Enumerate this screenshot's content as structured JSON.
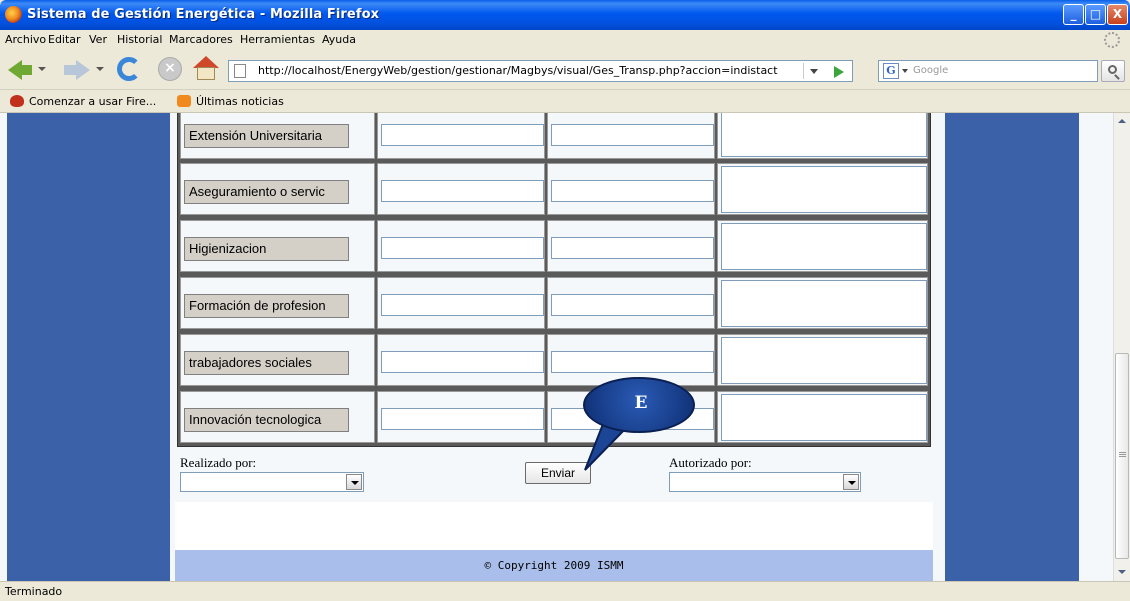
{
  "window": {
    "title": "Sistema de Gestión Energética - Mozilla Firefox",
    "min_glyph": "_",
    "max_glyph": "□",
    "close_glyph": "X"
  },
  "menu": {
    "items": [
      "Archivo",
      "Editar",
      "Ver",
      "Historial",
      "Marcadores",
      "Herramientas",
      "Ayuda"
    ]
  },
  "toolbar": {
    "url": "http://localhost/EnergyWeb/gestion/gestionar/Magbys/visual/Ges_Transp.php?accion=indistact",
    "search_placeholder": "Google",
    "search_engine_glyph": "G",
    "stop_glyph": "×"
  },
  "bookmarks": {
    "items": [
      "Comenzar a usar Fire...",
      "Últimas noticias"
    ]
  },
  "form": {
    "rows": [
      {
        "label": "Extensión Universitaria"
      },
      {
        "label": "Aseguramiento o servic"
      },
      {
        "label": "Higienizacion"
      },
      {
        "label": "Formación de profesion"
      },
      {
        "label": "trabajadores sociales"
      },
      {
        "label": "Innovación tecnologica"
      }
    ],
    "realizado_label": "Realizado por:",
    "autorizado_label": "Autorizado por:",
    "submit_label": "Enviar"
  },
  "callout": {
    "letter": "E",
    "fill_color": "#163B86"
  },
  "footer": {
    "copyright": "© Copyright 2009 ISMM"
  },
  "status": {
    "text": "Terminado"
  },
  "colors": {
    "side_panels": "#3B62A8",
    "footer_band": "#A9BEEA",
    "titlebar": "#0058EE"
  }
}
